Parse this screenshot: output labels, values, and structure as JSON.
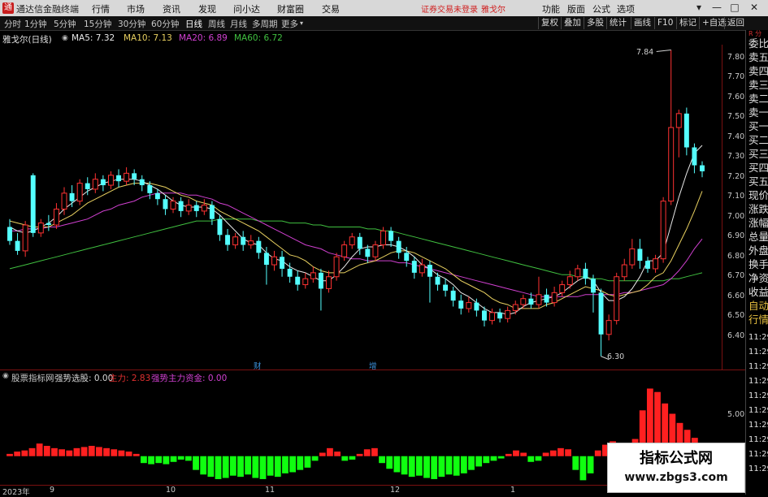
{
  "app": {
    "title": "通达信金融终端",
    "login_note": "证券交易未登录",
    "stock_short": "雅戈尔"
  },
  "menu": [
    "行情",
    "市场",
    "资讯",
    "发现",
    "问小达",
    "财富圈",
    "交易"
  ],
  "right_menu": [
    "功能",
    "版面",
    "公式",
    "选项"
  ],
  "periods": [
    "分时",
    "1分钟",
    "5分钟",
    "15分钟",
    "30分钟",
    "60分钟",
    "日线",
    "周线",
    "月线",
    "多周期",
    "更多"
  ],
  "active_period": "日线",
  "tools": [
    "复权",
    "叠加",
    "多股",
    "统计",
    "画线",
    "F10",
    "标记",
    "+自选",
    "返回"
  ],
  "chart": {
    "title": "雅戈尔(日线)",
    "ma": [
      {
        "label": "MA5: 7.32",
        "color": "#e8e8e8"
      },
      {
        "label": "MA10: 7.13",
        "color": "#e8d060"
      },
      {
        "label": "MA20: 6.89",
        "color": "#d040d0"
      },
      {
        "label": "MA60: 6.72",
        "color": "#40c040"
      }
    ],
    "high_label": "7.84",
    "low_label": "6.30",
    "event_labels": [
      "财",
      "增"
    ]
  },
  "price_axis": [
    "7.80",
    "7.70",
    "7.60",
    "7.50",
    "7.40",
    "7.30",
    "7.20",
    "7.10",
    "7.00",
    "6.90",
    "6.80",
    "6.70",
    "6.60",
    "6.50",
    "6.40"
  ],
  "right_panel": {
    "top_label": "R\n分",
    "items": [
      "委比",
      "卖五",
      "卖四",
      "卖三",
      "卖二",
      "卖一",
      "买一",
      "买二",
      "买三",
      "买四",
      "买五",
      "现价",
      "涨跌",
      "涨幅",
      "总量",
      "外盘",
      "换手",
      "净资",
      "收益",
      "自动",
      "行情"
    ],
    "times": [
      "11:29",
      "11:29",
      "11:29",
      "11:29",
      "11:29",
      "11:29",
      "11:29",
      "11:29",
      "11:29",
      "11:29"
    ]
  },
  "sub": {
    "name": "股票指标网",
    "indicators": [
      {
        "label": "强势选股: 0.00",
        "color": "#d8d8d8"
      },
      {
        "label": "主力: 2.83",
        "color": "#e03030"
      },
      {
        "label": "强势主力资金: 0.00",
        "color": "#d040d0"
      }
    ],
    "axis_label": "5.00"
  },
  "dates": [
    "2023年",
    "9",
    "10",
    "11",
    "12",
    "1"
  ],
  "watermark": {
    "title": "指标公式网",
    "url": "www.zbgs3.com"
  },
  "chart_data": {
    "type": "candlestick",
    "ylim": [
      6.25,
      7.85
    ],
    "candles": [
      [
        6.95,
        6.88,
        6.99,
        6.86
      ],
      [
        6.88,
        6.83,
        6.92,
        6.81
      ],
      [
        6.83,
        6.96,
        6.98,
        6.8
      ],
      [
        7.21,
        6.92,
        7.22,
        6.9
      ],
      [
        6.92,
        6.97,
        6.99,
        6.9
      ],
      [
        6.97,
        6.96,
        7.01,
        6.93
      ],
      [
        6.96,
        7.04,
        7.07,
        6.94
      ],
      [
        7.04,
        7.12,
        7.15,
        7.01
      ],
      [
        7.12,
        7.08,
        7.16,
        7.05
      ],
      [
        7.08,
        7.17,
        7.19,
        7.06
      ],
      [
        7.17,
        7.14,
        7.2,
        7.11
      ],
      [
        7.14,
        7.19,
        7.22,
        7.12
      ],
      [
        7.19,
        7.16,
        7.21,
        7.13
      ],
      [
        7.16,
        7.21,
        7.23,
        7.14
      ],
      [
        7.21,
        7.18,
        7.24,
        7.15
      ],
      [
        7.18,
        7.22,
        7.25,
        7.16
      ],
      [
        7.22,
        7.19,
        7.24,
        7.16
      ],
      [
        7.19,
        7.16,
        7.21,
        7.13
      ],
      [
        7.16,
        7.12,
        7.18,
        7.09
      ],
      [
        7.12,
        7.09,
        7.14,
        7.06
      ],
      [
        7.09,
        7.04,
        7.11,
        7.01
      ],
      [
        7.04,
        7.08,
        7.1,
        7.02
      ],
      [
        7.08,
        7.03,
        7.1,
        7.0
      ],
      [
        7.03,
        7.06,
        7.09,
        7.01
      ],
      [
        7.06,
        7.03,
        7.08,
        7.0
      ],
      [
        7.03,
        7.06,
        7.09,
        7.01
      ],
      [
        7.06,
        6.99,
        7.08,
        6.96
      ],
      [
        6.99,
        6.91,
        7.01,
        6.88
      ],
      [
        6.91,
        6.86,
        6.94,
        6.83
      ],
      [
        6.86,
        6.9,
        6.92,
        6.84
      ],
      [
        6.9,
        6.86,
        6.93,
        6.83
      ],
      [
        6.86,
        6.88,
        6.91,
        6.84
      ],
      [
        6.88,
        6.82,
        6.9,
        6.79
      ],
      [
        6.82,
        6.76,
        6.85,
        6.66
      ],
      [
        6.76,
        6.8,
        6.83,
        6.73
      ],
      [
        6.8,
        6.74,
        6.83,
        6.7
      ],
      [
        6.74,
        6.7,
        6.77,
        6.67
      ],
      [
        6.7,
        6.66,
        6.73,
        6.63
      ],
      [
        6.66,
        6.69,
        6.72,
        6.64
      ],
      [
        6.69,
        6.72,
        6.75,
        6.67
      ],
      [
        6.72,
        6.64,
        6.74,
        6.53
      ],
      [
        6.64,
        6.7,
        6.73,
        6.62
      ],
      [
        6.7,
        6.8,
        6.82,
        6.68
      ],
      [
        6.8,
        6.86,
        6.88,
        6.78
      ],
      [
        6.86,
        6.9,
        6.92,
        6.84
      ],
      [
        6.9,
        6.84,
        6.92,
        6.81
      ],
      [
        6.84,
        6.8,
        6.86,
        6.77
      ],
      [
        6.8,
        6.86,
        6.88,
        6.78
      ],
      [
        6.86,
        6.93,
        6.95,
        6.84
      ],
      [
        6.93,
        6.88,
        6.95,
        6.85
      ],
      [
        6.88,
        6.82,
        6.9,
        6.79
      ],
      [
        6.82,
        6.78,
        6.85,
        6.75
      ],
      [
        6.78,
        6.72,
        6.8,
        6.69
      ],
      [
        6.72,
        6.76,
        6.79,
        6.7
      ],
      [
        6.76,
        6.7,
        6.78,
        6.57
      ],
      [
        6.7,
        6.66,
        6.72,
        6.63
      ],
      [
        6.66,
        6.63,
        6.69,
        6.6
      ],
      [
        6.63,
        6.58,
        6.65,
        6.55
      ],
      [
        6.58,
        6.54,
        6.61,
        6.51
      ],
      [
        6.54,
        6.57,
        6.6,
        6.52
      ],
      [
        6.57,
        6.53,
        6.59,
        6.5
      ],
      [
        6.53,
        6.48,
        6.55,
        6.45
      ],
      [
        6.48,
        6.52,
        6.54,
        6.46
      ],
      [
        6.52,
        6.49,
        6.54,
        6.47
      ],
      [
        6.49,
        6.53,
        6.55,
        6.47
      ],
      [
        6.53,
        6.56,
        6.58,
        6.51
      ],
      [
        6.56,
        6.59,
        6.61,
        6.54
      ],
      [
        6.59,
        6.56,
        6.62,
        6.54
      ],
      [
        6.56,
        6.61,
        6.7,
        6.54
      ],
      [
        6.61,
        6.57,
        6.64,
        6.55
      ],
      [
        6.57,
        6.62,
        6.65,
        6.55
      ],
      [
        6.62,
        6.66,
        6.68,
        6.6
      ],
      [
        6.66,
        6.7,
        6.73,
        6.64
      ],
      [
        6.7,
        6.74,
        6.76,
        6.68
      ],
      [
        6.74,
        6.69,
        6.77,
        6.66
      ],
      [
        6.69,
        6.62,
        6.71,
        6.52
      ],
      [
        6.62,
        6.41,
        6.64,
        6.3
      ],
      [
        6.41,
        6.48,
        6.51,
        6.38
      ],
      [
        6.48,
        6.7,
        6.72,
        6.46
      ],
      [
        6.7,
        6.76,
        6.79,
        6.68
      ],
      [
        6.76,
        6.84,
        6.89,
        6.74
      ],
      [
        6.84,
        6.78,
        6.89,
        6.74
      ],
      [
        6.78,
        6.74,
        6.8,
        6.72
      ],
      [
        6.74,
        6.79,
        6.81,
        6.72
      ],
      [
        6.79,
        7.08,
        7.1,
        6.77
      ],
      [
        7.08,
        7.45,
        7.84,
        7.06
      ],
      [
        7.45,
        7.52,
        7.54,
        7.3
      ],
      [
        7.52,
        7.35,
        7.55,
        7.31
      ],
      [
        7.35,
        7.26,
        7.37,
        7.22
      ],
      [
        7.26,
        7.23,
        7.28,
        7.2
      ]
    ],
    "ma": {
      "MA5": [
        6.95,
        6.93,
        6.92,
        6.93,
        6.95,
        6.97,
        7.0,
        7.04,
        7.07,
        7.1,
        7.13,
        7.15,
        7.17,
        7.18,
        7.19,
        7.19,
        7.19,
        7.18,
        7.16,
        7.14,
        7.11,
        7.08,
        7.06,
        7.05,
        7.05,
        7.05,
        7.04,
        7.01,
        6.97,
        6.93,
        6.89,
        6.87,
        6.86,
        6.82,
        6.79,
        6.78,
        6.75,
        6.73,
        6.72,
        6.7,
        6.68,
        6.68,
        6.71,
        6.75,
        6.8,
        6.84,
        6.85,
        6.85,
        6.86,
        6.86,
        6.85,
        6.83,
        6.8,
        6.76,
        6.74,
        6.71,
        6.69,
        6.66,
        6.62,
        6.6,
        6.57,
        6.54,
        6.52,
        6.52,
        6.51,
        6.52,
        6.55,
        6.57,
        6.58,
        6.59,
        6.6,
        6.62,
        6.65,
        6.68,
        6.7,
        6.68,
        6.62,
        6.58,
        6.58,
        6.6,
        6.64,
        6.7,
        6.78,
        6.78,
        6.82,
        6.96,
        7.1,
        7.22,
        7.32,
        7.36
      ],
      "MA10": [
        6.98,
        6.97,
        6.96,
        6.95,
        6.95,
        6.95,
        6.97,
        6.99,
        7.01,
        7.04,
        7.07,
        7.09,
        7.11,
        7.13,
        7.15,
        7.16,
        7.17,
        7.17,
        7.17,
        7.16,
        7.15,
        7.13,
        7.11,
        7.1,
        7.08,
        7.07,
        7.06,
        7.03,
        7.01,
        6.99,
        6.97,
        6.95,
        6.93,
        6.9,
        6.87,
        6.84,
        6.81,
        6.8,
        6.78,
        6.75,
        6.73,
        6.72,
        6.72,
        6.72,
        6.74,
        6.76,
        6.77,
        6.78,
        6.8,
        6.82,
        6.83,
        6.83,
        6.82,
        6.8,
        6.78,
        6.76,
        6.74,
        6.71,
        6.68,
        6.66,
        6.64,
        6.62,
        6.59,
        6.57,
        6.56,
        6.54,
        6.54,
        6.54,
        6.54,
        6.56,
        6.57,
        6.59,
        6.61,
        6.63,
        6.65,
        6.64,
        6.63,
        6.61,
        6.6,
        6.61,
        6.62,
        6.63,
        6.66,
        6.7,
        6.72,
        6.78,
        6.86,
        6.94,
        7.03,
        7.13
      ],
      "MA20": [
        6.93,
        6.93,
        6.94,
        6.94,
        6.94,
        6.95,
        6.95,
        6.96,
        6.97,
        6.98,
        6.99,
        7.01,
        7.03,
        7.04,
        7.06,
        7.07,
        7.08,
        7.1,
        7.11,
        7.12,
        7.12,
        7.12,
        7.12,
        7.11,
        7.11,
        7.1,
        7.09,
        7.07,
        7.06,
        7.04,
        7.02,
        7.0,
        6.98,
        6.96,
        6.94,
        6.92,
        6.9,
        6.88,
        6.86,
        6.85,
        6.84,
        6.82,
        6.81,
        6.8,
        6.79,
        6.79,
        6.78,
        6.78,
        6.78,
        6.78,
        6.77,
        6.77,
        6.76,
        6.75,
        6.74,
        6.73,
        6.72,
        6.71,
        6.7,
        6.69,
        6.68,
        6.67,
        6.66,
        6.65,
        6.64,
        6.63,
        6.62,
        6.61,
        6.6,
        6.6,
        6.6,
        6.6,
        6.6,
        6.6,
        6.61,
        6.61,
        6.61,
        6.61,
        6.61,
        6.62,
        6.62,
        6.63,
        6.64,
        6.65,
        6.66,
        6.69,
        6.73,
        6.78,
        6.84,
        6.89
      ],
      "MA60": [
        6.74,
        6.75,
        6.76,
        6.77,
        6.78,
        6.79,
        6.8,
        6.81,
        6.82,
        6.83,
        6.84,
        6.85,
        6.86,
        6.87,
        6.88,
        6.89,
        6.9,
        6.91,
        6.92,
        6.93,
        6.94,
        6.95,
        6.96,
        6.97,
        6.98,
        6.98,
        6.98,
        6.99,
        6.99,
        6.99,
        6.99,
        6.99,
        6.98,
        6.98,
        6.98,
        6.98,
        6.97,
        6.97,
        6.97,
        6.96,
        6.96,
        6.95,
        6.95,
        6.95,
        6.95,
        6.95,
        6.94,
        6.94,
        6.93,
        6.93,
        6.92,
        6.91,
        6.9,
        6.89,
        6.88,
        6.87,
        6.86,
        6.85,
        6.84,
        6.83,
        6.82,
        6.81,
        6.8,
        6.79,
        6.78,
        6.77,
        6.76,
        6.75,
        6.74,
        6.73,
        6.72,
        6.71,
        6.71,
        6.7,
        6.7,
        6.69,
        6.69,
        6.68,
        6.68,
        6.68,
        6.68,
        6.68,
        6.68,
        6.68,
        6.68,
        6.69,
        6.69,
        6.7,
        6.71,
        6.72
      ]
    },
    "sub_ylim": [
      -2.5,
      6.5
    ],
    "sub_values": [
      0.2,
      0.4,
      0.5,
      0.7,
      1.1,
      0.9,
      0.7,
      0.6,
      0.5,
      0.7,
      0.8,
      0.9,
      0.8,
      0.7,
      0.6,
      0.5,
      0.4,
      0.2,
      -0.6,
      -0.7,
      -0.6,
      -0.7,
      -0.5,
      -0.3,
      -0.4,
      -1.2,
      -1.6,
      -1.8,
      -2.0,
      -1.9,
      -1.7,
      -1.8,
      -1.6,
      -1.9,
      -2.0,
      -1.7,
      -1.8,
      -1.5,
      -1.4,
      -1.2,
      -1.0,
      -0.4,
      0.3,
      0.7,
      0.4,
      -0.4,
      -0.3,
      0.2,
      0.6,
      0.7,
      -0.6,
      -1.1,
      -1.4,
      -1.6,
      -1.8,
      -1.7,
      -1.9,
      -2.0,
      -1.8,
      -1.6,
      -1.7,
      -1.5,
      -1.2,
      -0.9,
      -0.6,
      -0.4,
      -0.2,
      0.2,
      0.5,
      0.3,
      -0.5,
      -0.4,
      0.3,
      0.5,
      0.7,
      0.6,
      -1.2,
      -2.1,
      -1.5,
      0.5,
      1.0,
      1.3,
      1.1,
      0.8,
      1.5,
      4.0,
      5.9,
      5.6,
      4.6,
      3.7,
      2.9,
      2.3,
      1.6,
      1.1
    ]
  }
}
